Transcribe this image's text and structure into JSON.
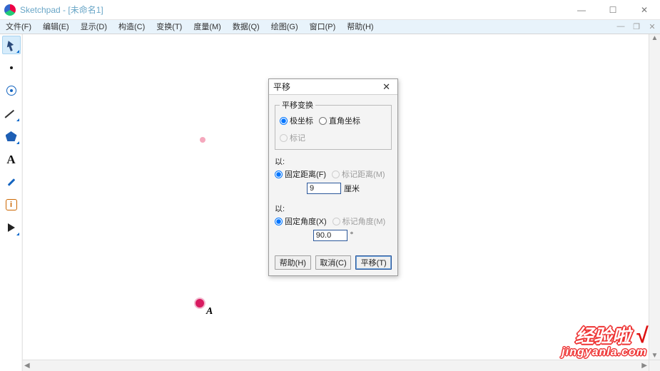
{
  "title": "Sketchpad  - [未命名1]",
  "menu": {
    "file": "文件(F)",
    "edit": "编辑(E)",
    "display": "显示(D)",
    "construct": "构造(C)",
    "transform": "变换(T)",
    "measure": "度量(M)",
    "data": "数据(Q)",
    "draw": "绘图(G)",
    "window": "窗口(P)",
    "help": "帮助(H)"
  },
  "toolbar": {
    "arrow": "selection-arrow",
    "point": "point-tool",
    "compass": "compass-tool",
    "line": "line-tool",
    "polygon": "polygon-tool",
    "text": "text-tool",
    "pen": "marker-tool",
    "info": "info-tool",
    "custom": "custom-tool",
    "text_glyph": "A"
  },
  "canvas": {
    "ghost_point_label": "",
    "selected_point_label": "A"
  },
  "dialog": {
    "title": "平移",
    "legend_vector": "平移变换",
    "opt_polar": "极坐标",
    "opt_rect": "直角坐标",
    "opt_mark": "标记",
    "legend_by1": "以:",
    "opt_fixed_dist": "固定距离(F)",
    "opt_mark_dist": "标记距离(M)",
    "dist_value": "9",
    "dist_unit": "厘米",
    "legend_by2": "以:",
    "opt_fixed_ang": "固定角度(X)",
    "opt_mark_ang": "标记角度(M)",
    "ang_value": "90.0",
    "btn_help": "帮助(H)",
    "btn_cancel": "取消(C)",
    "btn_apply": "平移(T)"
  },
  "watermark": {
    "line1": "经验啦",
    "check": "√",
    "line2": "jingyanla.com"
  }
}
